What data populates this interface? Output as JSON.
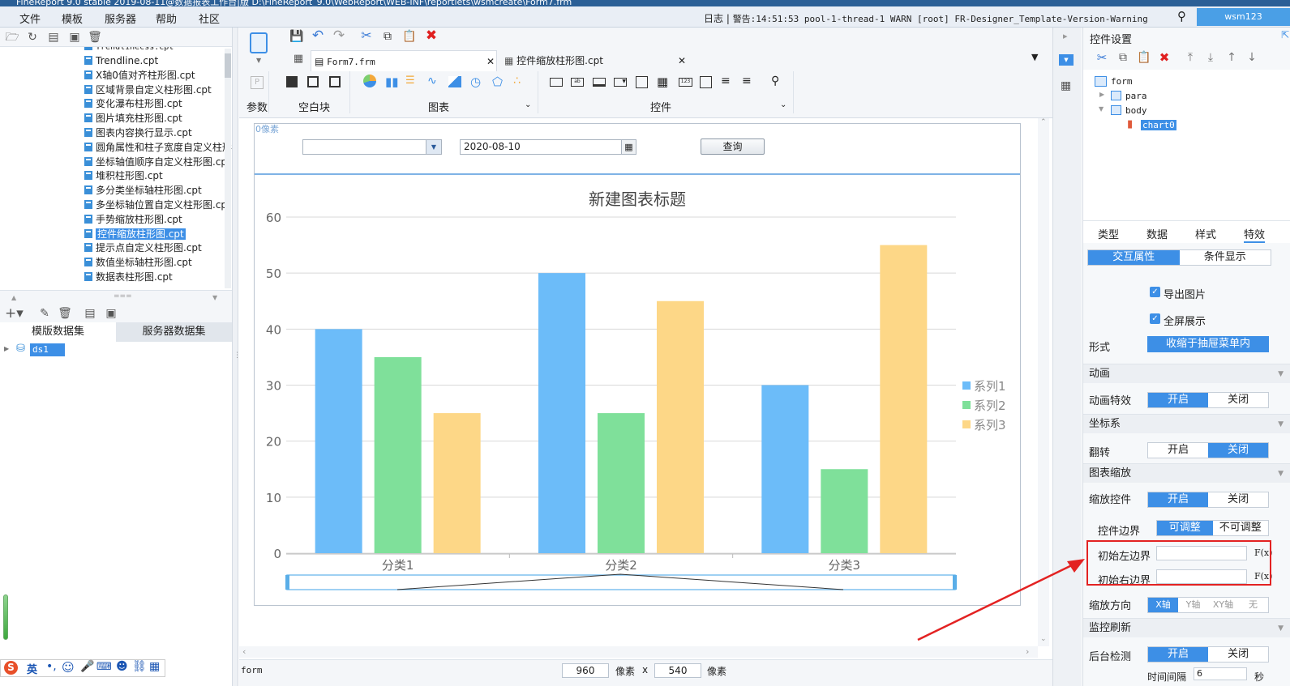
{
  "window": {
    "title": "FineReport 9.0 stable 2019-08-11@数据报表工作台|版 D:\\FineReport_9.0\\WebReport\\WEB-INF\\reportlets\\wsmcreate\\Form7.frm"
  },
  "menubar": {
    "items": [
      "文件",
      "模板",
      "服务器",
      "帮助",
      "社区"
    ],
    "log_label": "日志",
    "log_message": "警告:14:51:53 pool-1-thread-1 WARN [root] FR-Designer_Template-Version-Warning",
    "user": "wsm123"
  },
  "file_tree": {
    "items": [
      "Trendline.cpt",
      "X轴0值对齐柱形图.cpt",
      "区域背景自定义柱形图.cpt",
      "变化瀑布柱形图.cpt",
      "图片填充柱形图.cpt",
      "图表内容换行显示.cpt",
      "圆角属性和柱子宽度自定义柱形",
      "坐标轴值顺序自定义柱形图.cp",
      "堆积柱形图.cpt",
      "多分类坐标轴柱形图.cpt",
      "多坐标轴位置自定义柱形图.cp",
      "手势缩放柱形图.cpt",
      "控件缩放柱形图.cpt",
      "提示点自定义柱形图.cpt",
      "数值坐标轴柱形图.cpt",
      "数据表柱形图.cpt"
    ],
    "selected_index": 12
  },
  "dataset": {
    "tabs": [
      "模版数据集",
      "服务器数据集"
    ],
    "items": [
      "ds1"
    ]
  },
  "editor": {
    "tabs": [
      "Form7.frm",
      "控件缩放柱形图.cpt"
    ],
    "groups": [
      "参数",
      "空白块",
      "图表",
      "控件"
    ]
  },
  "form": {
    "px_label": "0像素",
    "date_value": "2020-08-10",
    "query_label": "查询"
  },
  "chart_data": {
    "type": "bar",
    "title": "新建图表标题",
    "categories": [
      "分类1",
      "分类2",
      "分类3"
    ],
    "series": [
      {
        "name": "系列1",
        "values": [
          40,
          50,
          30
        ],
        "color": "#6cbcf9"
      },
      {
        "name": "系列2",
        "values": [
          35,
          25,
          15
        ],
        "color": "#7fe09a"
      },
      {
        "name": "系列3",
        "values": [
          25,
          45,
          55
        ],
        "color": "#fdd787"
      }
    ],
    "ylim": [
      0,
      60
    ],
    "yticks": [
      0,
      10,
      20,
      30,
      40,
      50,
      60
    ],
    "legend": "right",
    "grid": true
  },
  "status": {
    "widget_name": "form",
    "width": "960",
    "height": "540",
    "unit": "像素",
    "times": "x"
  },
  "right_panel": {
    "title": "控件设置",
    "tree": [
      "form",
      "para",
      "body",
      "chart0"
    ],
    "tabs": [
      "类型",
      "数据",
      "样式",
      "特效"
    ],
    "subtabs": [
      "交互属性",
      "条件显示"
    ],
    "export_image": "导出图片",
    "fullscreen": "全屏展示",
    "form_label": "形式",
    "form_value": "收缩于抽屉菜单内",
    "sec_animation": "动画",
    "animation_label": "动画特效",
    "sec_axis": "坐标系",
    "flip_label": "翻转",
    "sec_zoom": "图表缩放",
    "zoom_ctrl_label": "缩放控件",
    "ctrl_border_label": "控件边界",
    "adjustable": "可调整",
    "not_adjustable": "不可调整",
    "init_left": "初始左边界",
    "init_right": "初始右边界",
    "fx": "F(x)",
    "zoom_dir_label": "缩放方向",
    "dir_options": [
      "X轴",
      "Y轴",
      "XY轴",
      "无"
    ],
    "sec_monitor": "监控刷新",
    "backend_label": "后台检测",
    "interval_label": "时间间隔",
    "interval_value": "6",
    "interval_unit": "秒",
    "on": "开启",
    "off": "关闭"
  }
}
